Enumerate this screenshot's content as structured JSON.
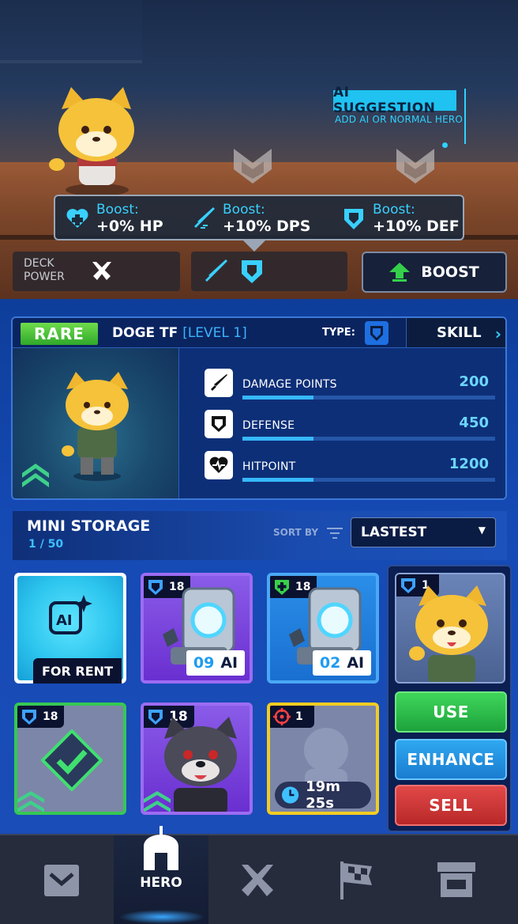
{
  "scene": {
    "ai_suggestion": {
      "title": "AI SUGGESTION",
      "subtitle": "ADD AI OR NORMAL HERO"
    },
    "boosts": [
      {
        "label": "Boost:",
        "value": "+0% HP",
        "icon": "heart-plus-icon"
      },
      {
        "label": "Boost:",
        "value": "+10% DPS",
        "icon": "sword-icon"
      },
      {
        "label": "Boost:",
        "value": "+10% DEF",
        "icon": "shield-icon"
      }
    ],
    "deck_power_label": "DECK\nPOWER",
    "boost_button": "BOOST"
  },
  "hero": {
    "rarity": "RARE",
    "name": "DOGE TF",
    "level": "[LEVEL 1]",
    "type_label": "TYPE:",
    "skill_button": "SKILL",
    "stats": [
      {
        "name": "DAMAGE POINTS",
        "value": "200",
        "icon": "sword-icon"
      },
      {
        "name": "DEFENSE",
        "value": "450",
        "icon": "shield-icon"
      },
      {
        "name": "HITPOINT",
        "value": "1200",
        "icon": "heart-pulse-icon"
      }
    ]
  },
  "storage": {
    "title": "MINI STORAGE",
    "count": "1 / 50",
    "sort_by_label": "SORT BY",
    "sort_value": "LASTEST",
    "cards": [
      {
        "kind": "rent",
        "label": "FOR RENT"
      },
      {
        "kind": "robot",
        "badge": "18",
        "ai_number": "09",
        "ai_label": "AI",
        "class": "shield"
      },
      {
        "kind": "robot",
        "badge": "18",
        "ai_number": "02",
        "ai_label": "AI",
        "class": "heal"
      },
      {
        "kind": "selected",
        "badge": "1",
        "class": "shield"
      },
      {
        "kind": "checked",
        "badge": "18",
        "class": "shield"
      },
      {
        "kind": "wolf",
        "badge": "18",
        "class": "shield"
      },
      {
        "kind": "timer",
        "badge": "1",
        "timer": "19m 25s",
        "class": "target"
      }
    ],
    "actions": {
      "use": "USE",
      "enhance": "ENHANCE",
      "sell": "SELL"
    }
  },
  "nav": {
    "items": [
      {
        "name": "inbox",
        "icon": "down-chevron-icon"
      },
      {
        "name": "hero",
        "label": "HERO",
        "icon": "helmet-icon",
        "active": true
      },
      {
        "name": "battle",
        "icon": "crossed-swords-icon"
      },
      {
        "name": "missions",
        "icon": "flags-icon"
      },
      {
        "name": "shop",
        "icon": "store-icon"
      }
    ]
  },
  "colors": {
    "accent": "#39d0ff",
    "rare_green": "#4cc63a",
    "use_green": "#22b84a",
    "enhance_blue": "#1d8fe0",
    "sell_red": "#d23a3a"
  }
}
